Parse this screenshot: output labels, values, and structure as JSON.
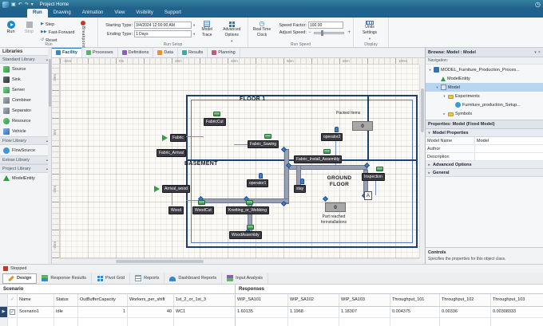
{
  "colors": {
    "titlebar_blue": "#2a6d99",
    "accent_blue": "#2878c8",
    "selection_blue": "#b8d6f0",
    "status_red": "#c0392b",
    "node_dark": "#3a3a40",
    "wall_navy": "#1d3f74",
    "path_gray": "#9aa0b4"
  },
  "titlebar": {
    "file_tab": "Project Home"
  },
  "ribbon_tabs": {
    "run": "Run",
    "drawing": "Drawing",
    "animation": "Animation",
    "view": "View",
    "visibility": "Visibility",
    "support": "Support"
  },
  "ribbon": {
    "run_group": {
      "label": "Run",
      "run": "Run",
      "stop": "Stop",
      "step": "Step",
      "fast_forward": "Fast-Forward",
      "reset": "Reset",
      "breakpoint": "Breakpoint"
    },
    "run_setup": {
      "label": "Run Setup",
      "starting_type_label": "Starting Type:",
      "starting_type_value": "3/4/2024 12:00:00 AM",
      "ending_type_label": "Ending Type:",
      "ending_type_value": "1 Days",
      "model_trace_line1": "Model",
      "model_trace_line2": "Trace",
      "advanced_line1": "Advanced",
      "advanced_line2": "Options"
    },
    "run_speed": {
      "label": "Run Speed",
      "real_time_line1": "Real Time",
      "real_time_line2": "Clock",
      "speed_factor_label": "Speed Factor:",
      "speed_factor_value": "100.00",
      "adjust_speed_label": "Adjust Speed:"
    },
    "display": {
      "label": "Display",
      "units_line1": "Units",
      "units_line2": "Settings"
    }
  },
  "libraries": {
    "title": "Libraries",
    "standard_header": "Standard Library",
    "standard_items": [
      "Source",
      "Sink",
      "Server",
      "Combiner",
      "Separator",
      "Resource",
      "Vehicle"
    ],
    "flow_header": "Flow Library",
    "flow_items": [
      "FlowSource"
    ],
    "extras_header": "Extras Library",
    "project_header": "Project Library",
    "project_items": [
      "ModelEntity"
    ]
  },
  "doc_tabs": {
    "facility": "Facility",
    "processes": "Processes",
    "definitions": "Definitions",
    "data": "Data",
    "results": "Results",
    "planning": "Planning"
  },
  "rulers": {
    "h": [
      "-20m",
      "0m",
      "20m",
      "40m",
      "60m",
      "80m",
      "100m"
    ],
    "v": [
      "20m",
      "0m",
      "-20m",
      "-40m"
    ]
  },
  "canvas": {
    "floor1": "FLOOR 1",
    "basement": "BASEMENT",
    "ground_line1": "GROUND",
    "ground_line2": "FLOOR",
    "packed_items": "Packed Items",
    "packed_count": "0",
    "part_line1": "Part reached",
    "part_line2": "forinstallations",
    "part_count": "0",
    "marker_a": "A",
    "nodes": {
      "fabriccut": "FabricCut",
      "fabric": "Fabric",
      "fabric_arrival": "Fabric_Arrival",
      "fabric_sawing": "Fabric_Sawing",
      "operator2": "operator2",
      "fabric_install_assembly": "Fabric_Install_Assembly",
      "inspection": "Inspection",
      "arrival_wood": "Arrival_wood",
      "operator1": "operator1",
      "stay": "stay",
      "wood": "Wood",
      "woodcut": "WoodCut",
      "knetting_or_webbing": "Knetting_or_Webbing",
      "woodassembly": "WoodAssembly"
    }
  },
  "browse_panel": {
    "title": "Browse: Model : Model",
    "navigation_label": "Navigation:",
    "tree": {
      "root": "MODEL_Furniture_Production_Proces...",
      "model_entity": "ModelEntity",
      "model": "Model",
      "experiments": "Experiments",
      "setup": "Furniture_production_Setup...",
      "symbols": "Symbols"
    },
    "properties_title": "Properties: Model (Fixed Model)",
    "prop_category_model": "Model Properties",
    "prop_model_name_label": "Model Name",
    "prop_model_name_value": "Model",
    "prop_author_label": "Author",
    "prop_description_label": "Description",
    "prop_category_advanced": "Advanced Options",
    "prop_category_general": "General",
    "controls_title": "Controls",
    "controls_description": "Specifies the properties for this object class."
  },
  "status_bar": {
    "status": "Stopped"
  },
  "bottom_tabs": {
    "design": "Design",
    "response_results": "Response Results",
    "pivot_grid": "Pivot Grid",
    "reports": "Reports",
    "dashboard_reports": "Dashboard Reports",
    "input_analysis": "Input Analysis"
  },
  "experiment_table": {
    "group_scenario": "Scenario",
    "group_responses": "Responses",
    "columns": {
      "name": "Name",
      "status": "Status",
      "outbuffer": "OutBufferCapacity",
      "workers": "Workers_per_shift",
      "shift": "1st_2_or_1st_3",
      "wip1": "WIP_SA101",
      "wip2": "WIP_SA102",
      "wip3": "WIP_SA103",
      "tp1": "Throughput_101",
      "tp2": "Throughput_102",
      "tp3": "Throughput_103"
    },
    "row": {
      "name": "Scenario1",
      "status": "Idle",
      "outbuffer": "1",
      "workers": "40",
      "shift": "WC1",
      "wip1": "1.60135",
      "wip2": "1.1968",
      "wip3": "1.18307",
      "tp1": "0.004375",
      "tp2": "0.00336",
      "tp3": "0.00308333"
    }
  }
}
